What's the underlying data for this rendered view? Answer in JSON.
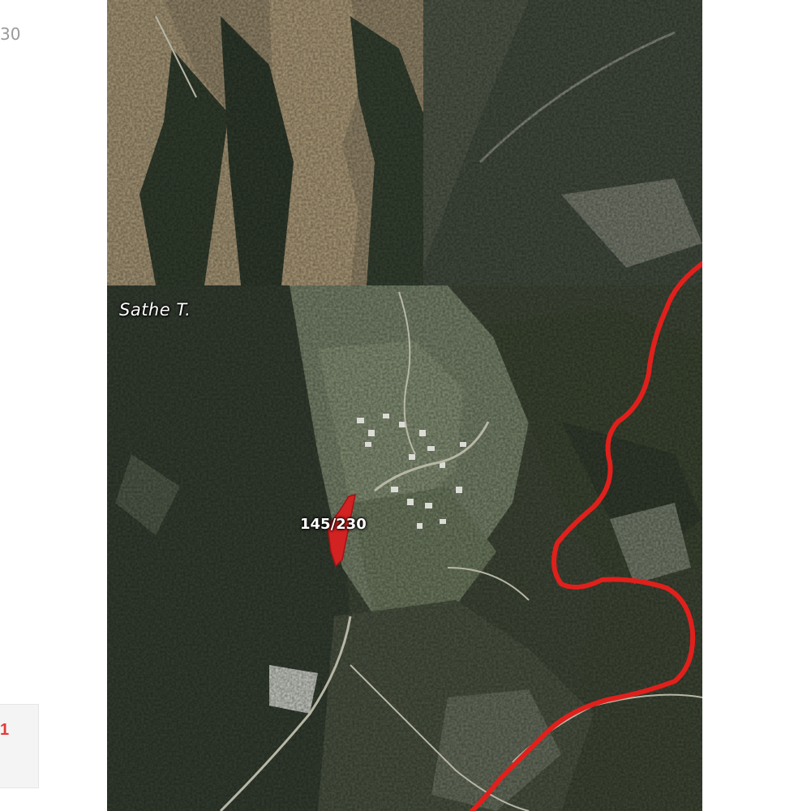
{
  "edge_text": "30",
  "widget_mark": "1",
  "map": {
    "place_label": "Sathe T.",
    "parcel_label": "145/230",
    "parcel_color": "#d32222",
    "boundary_color": "#e0201c"
  }
}
